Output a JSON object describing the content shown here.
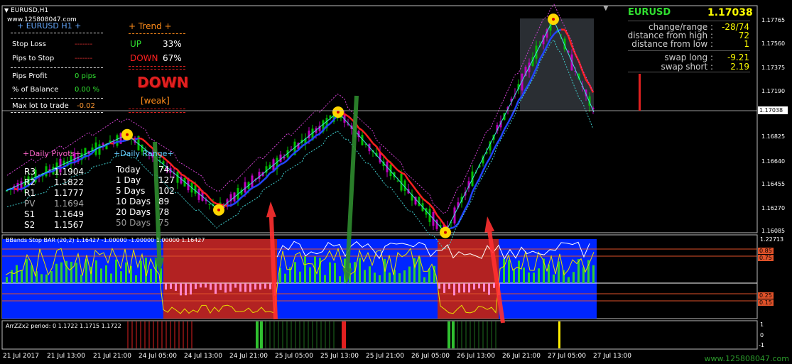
{
  "window": {
    "symbol_title": "EURUSD,H1",
    "watermark_top": "www.125808047.com",
    "watermark_bottom": "www.125808047.com"
  },
  "left_panel": {
    "header": "+ EURUSD H1 +",
    "stop_loss_label": "Stop Loss",
    "stop_loss_value": "-------",
    "pips_to_stop_label": "Pips to Stop",
    "pips_to_stop_value": "-------",
    "pips_profit_label": "Pips Profit",
    "pips_profit_value": "0 pips",
    "pct_balance_label": "% of Balance",
    "pct_balance_value": "0.00 %",
    "max_lot_label": "Max lot to trade",
    "max_lot_value": "-0.02"
  },
  "trend_panel": {
    "header": "+ Trend +",
    "up_label": "UP",
    "up_value": "33%",
    "down_label": "DOWN",
    "down_value": "67%",
    "signal": "DOWN",
    "strength": "[weak]"
  },
  "daily_pivots": {
    "header": "+Daily Pivots+",
    "rows": [
      {
        "label": "R3",
        "value": "1.1904"
      },
      {
        "label": "R2",
        "value": "1.1822"
      },
      {
        "label": "R1",
        "value": "1.1777"
      },
      {
        "label": "PV",
        "value": "1.1694"
      },
      {
        "label": "S1",
        "value": "1.1649"
      },
      {
        "label": "S2",
        "value": "1.1567"
      }
    ]
  },
  "daily_range": {
    "header": "+Daily Range+",
    "rows": [
      {
        "label": "Today",
        "value": "74"
      },
      {
        "label": "1 Day",
        "value": "127"
      },
      {
        "label": "5 Days",
        "value": "102"
      },
      {
        "label": "10 Days",
        "value": "89"
      },
      {
        "label": "20 Days",
        "value": "78"
      },
      {
        "label": "50 Days",
        "value": "75"
      }
    ]
  },
  "right_panel": {
    "symbol": "EURUSD",
    "price": "1.17038",
    "rows": [
      {
        "label": "change/range :",
        "value": "-28/74"
      },
      {
        "label": "distance from high :",
        "value": "72"
      },
      {
        "label": "distance from low :",
        "value": "1"
      },
      {
        "label": "swap long :",
        "value": "-9.21"
      },
      {
        "label": "swap short :",
        "value": "2.19"
      }
    ]
  },
  "price_axis": {
    "labels": [
      "1.17765",
      "1.17560",
      "1.17375",
      "1.17190",
      "1.16825",
      "1.16640",
      "1.16455",
      "1.16270",
      "1.16085"
    ],
    "current": "1.17038"
  },
  "indicator1": {
    "title": "BBands Stop BAR (20,2) 1.16427 -1.00000 -1.00000 1.00000 1.16427",
    "axis_top": "1.22713",
    "levels": [
      "0.85",
      "0.75",
      "0.25",
      "0.15"
    ]
  },
  "indicator2": {
    "title": "ArrZZx2 period: 0 1.1722 1.1715 1.1722",
    "axis_labels": [
      "1",
      "0",
      "-1"
    ]
  },
  "time_axis": [
    "21 Jul 2017",
    "21 Jul 13:00",
    "21 Jul 21:00",
    "24 Jul 05:00",
    "24 Jul 13:00",
    "24 Jul 21:00",
    "25 Jul 05:00",
    "25 Jul 13:00",
    "25 Jul 21:00",
    "26 Jul 05:00",
    "26 Jul 13:00",
    "26 Jul 21:00",
    "27 Jul 05:00",
    "27 Jul 13:00"
  ],
  "colors": {
    "bull": "#00c000",
    "bear": "#c000c0",
    "ma": "#ff2020",
    "zigzag": "#40e0e0",
    "blue_zone": "#0026ff",
    "red_zone": "#b22222",
    "dot": "#ffd700"
  }
}
